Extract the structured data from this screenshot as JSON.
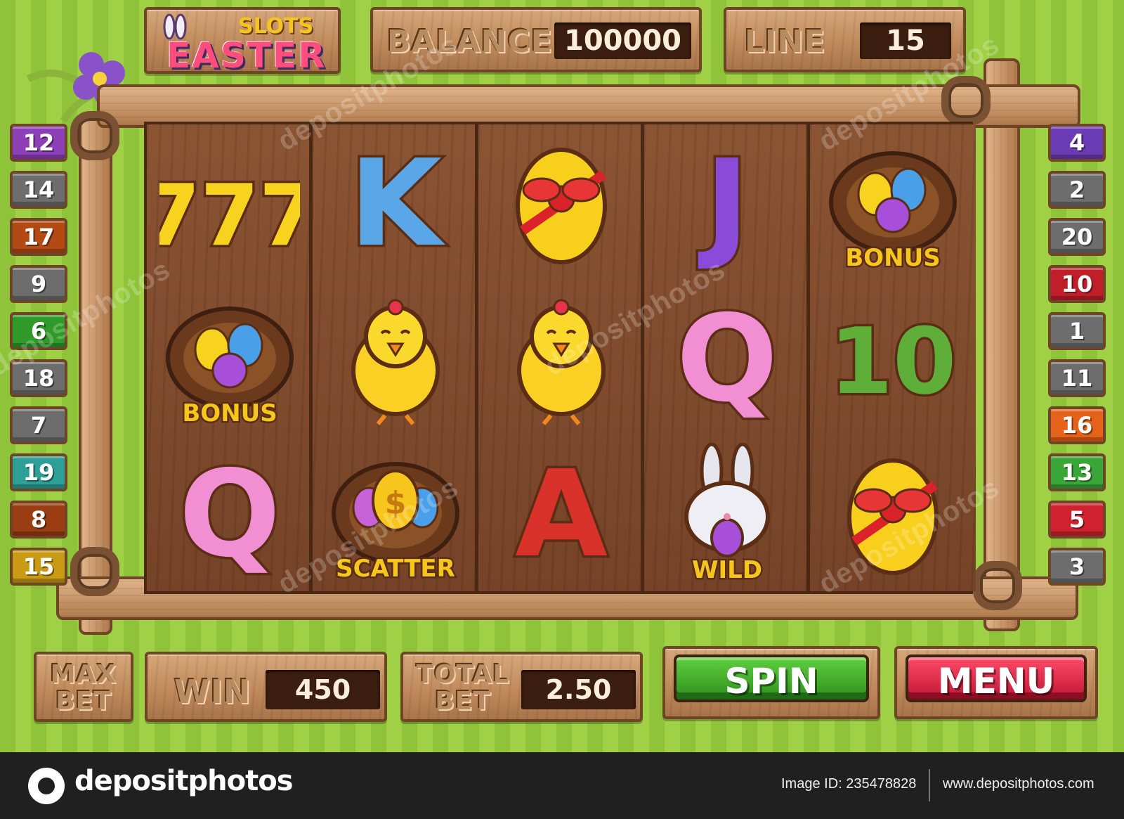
{
  "logo": {
    "top_word": "SLOTS",
    "main_word": "EASTER"
  },
  "header": {
    "balance_label": "BALANCE",
    "balance_value": "100000",
    "line_label": "LINE",
    "line_value": "15"
  },
  "reels": [
    [
      {
        "type": "seven",
        "text": "777"
      },
      {
        "type": "nest",
        "text": "BONUS"
      },
      {
        "type": "letter",
        "text": "Q",
        "color": "#f28fd3"
      }
    ],
    [
      {
        "type": "letter",
        "text": "K",
        "color": "#5aa6e6"
      },
      {
        "type": "chick",
        "text": ""
      },
      {
        "type": "scatter",
        "text": "SCATTER"
      }
    ],
    [
      {
        "type": "egg",
        "text": ""
      },
      {
        "type": "chick",
        "text": ""
      },
      {
        "type": "letter",
        "text": "A",
        "color": "#d8322a"
      }
    ],
    [
      {
        "type": "letter",
        "text": "J",
        "color": "#8a4bd8"
      },
      {
        "type": "letter",
        "text": "Q",
        "color": "#f28fd3"
      },
      {
        "type": "wild",
        "text": "WILD"
      }
    ],
    [
      {
        "type": "nest",
        "text": "BONUS"
      },
      {
        "type": "ten",
        "text": "10"
      },
      {
        "type": "egg",
        "text": ""
      }
    ]
  ],
  "left_lines": [
    {
      "num": "12",
      "color": "#8d3fb8"
    },
    {
      "num": "14",
      "color": "#6d6d6d"
    },
    {
      "num": "17",
      "color": "#b34a14"
    },
    {
      "num": "9",
      "color": "#6d6d6d"
    },
    {
      "num": "6",
      "color": "#2f9a2a"
    },
    {
      "num": "18",
      "color": "#6d6d6d"
    },
    {
      "num": "7",
      "color": "#6d6d6d"
    },
    {
      "num": "19",
      "color": "#2d9f97"
    },
    {
      "num": "8",
      "color": "#9a3d12"
    },
    {
      "num": "15",
      "color": "#c99a14"
    }
  ],
  "right_lines": [
    {
      "num": "4",
      "color": "#6b3bb3"
    },
    {
      "num": "2",
      "color": "#6d6d6d"
    },
    {
      "num": "20",
      "color": "#6d6d6d"
    },
    {
      "num": "10",
      "color": "#c01f2a"
    },
    {
      "num": "1",
      "color": "#6d6d6d"
    },
    {
      "num": "11",
      "color": "#6d6d6d"
    },
    {
      "num": "16",
      "color": "#e5621a"
    },
    {
      "num": "13",
      "color": "#3aa637"
    },
    {
      "num": "5",
      "color": "#d0222e"
    },
    {
      "num": "3",
      "color": "#6d6d6d"
    }
  ],
  "controls": {
    "maxbet_line1": "MAX",
    "maxbet_line2": "BET",
    "win_label": "WIN",
    "win_value": "450",
    "totalbet_line1": "TOTAL",
    "totalbet_line2": "BET",
    "totalbet_value": "2.50",
    "spin_label": "SPIN",
    "menu_label": "MENU"
  },
  "watermark": {
    "text": "depositphotos",
    "brand": "depositphotos",
    "image_id": "Image ID: 235478828",
    "url": "www.depositphotos.com"
  },
  "colors": {
    "spin": "#3fae2a",
    "menu": "#e8213f",
    "background_green": "#9fd046"
  }
}
